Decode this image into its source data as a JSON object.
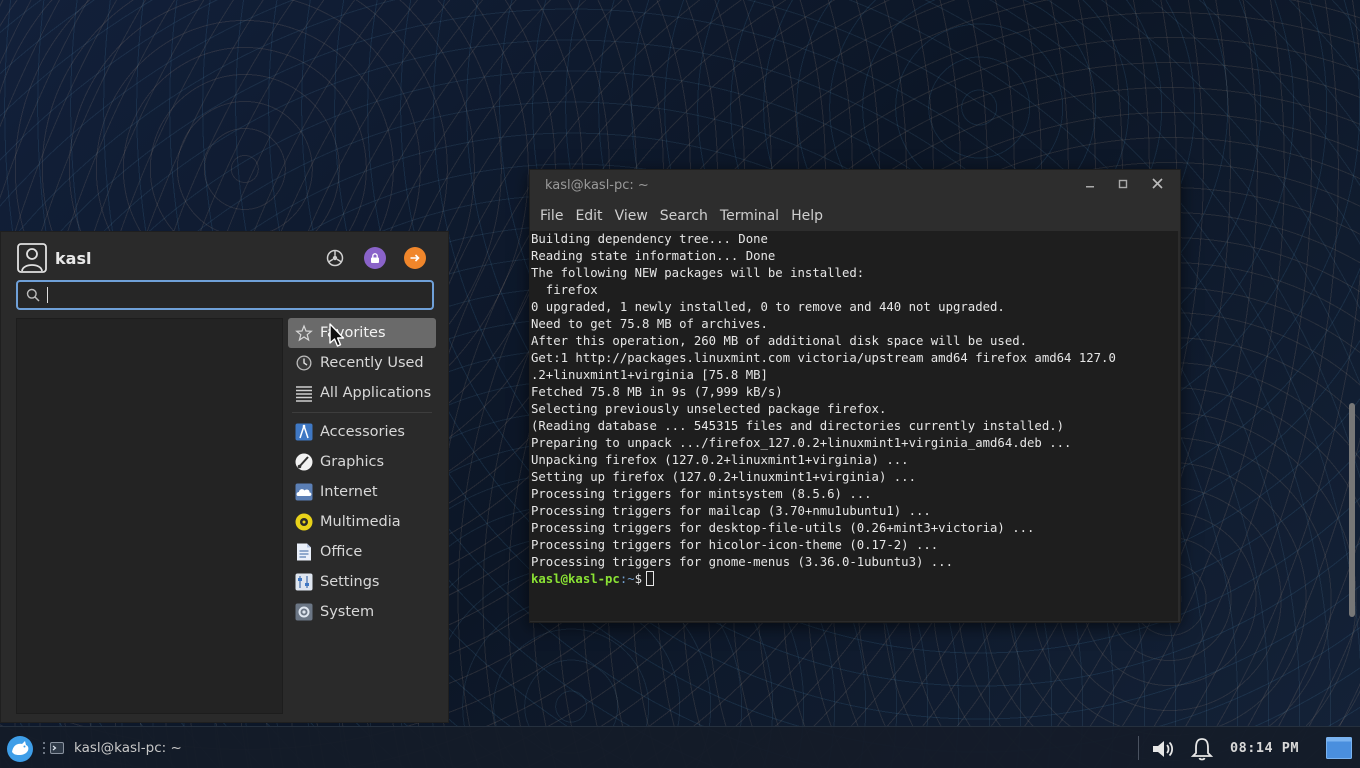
{
  "terminal": {
    "title": "kasl@kasl-pc: ~",
    "menu": [
      "File",
      "Edit",
      "View",
      "Search",
      "Terminal",
      "Help"
    ],
    "lines": [
      "Building dependency tree... Done",
      "Reading state information... Done",
      "The following NEW packages will be installed:",
      "  firefox",
      "0 upgraded, 1 newly installed, 0 to remove and 440 not upgraded.",
      "Need to get 75.8 MB of archives.",
      "After this operation, 260 MB of additional disk space will be used.",
      "Get:1 http://packages.linuxmint.com victoria/upstream amd64 firefox amd64 127.0",
      ".2+linuxmint1+virginia [75.8 MB]",
      "Fetched 75.8 MB in 9s (7,999 kB/s)",
      "Selecting previously unselected package firefox.",
      "(Reading database ... 545315 files and directories currently installed.)",
      "Preparing to unpack .../firefox_127.0.2+linuxmint1+virginia_amd64.deb ...",
      "Unpacking firefox (127.0.2+linuxmint1+virginia) ...",
      "Setting up firefox (127.0.2+linuxmint1+virginia) ...",
      "Processing triggers for mintsystem (8.5.6) ...",
      "Processing triggers for mailcap (3.70+nmu1ubuntu1) ...",
      "Processing triggers for desktop-file-utils (0.26+mint3+victoria) ...",
      "Processing triggers for hicolor-icon-theme (0.17-2) ...",
      "Processing triggers for gnome-menus (3.36.0-1ubuntu3) ..."
    ],
    "prompt": {
      "user": "kasl@kasl-pc",
      "path": ":~",
      "symbol": "$"
    }
  },
  "whisker": {
    "username": "kasl",
    "search": {
      "value": "",
      "placeholder": ""
    },
    "categories_top": [
      {
        "label": "Favorites",
        "icon": "star-icon",
        "selected": true
      },
      {
        "label": "Recently Used",
        "icon": "clock-icon",
        "selected": false
      },
      {
        "label": "All Applications",
        "icon": "list-icon",
        "selected": false
      }
    ],
    "categories": [
      {
        "label": "Accessories",
        "icon": "accessories-icon"
      },
      {
        "label": "Graphics",
        "icon": "graphics-icon"
      },
      {
        "label": "Internet",
        "icon": "internet-icon"
      },
      {
        "label": "Multimedia",
        "icon": "multimedia-icon"
      },
      {
        "label": "Office",
        "icon": "office-icon"
      },
      {
        "label": "Settings",
        "icon": "settings-icon"
      },
      {
        "label": "System",
        "icon": "system-icon"
      }
    ],
    "actions": [
      {
        "name": "settings-manager-icon",
        "color": "#2a2a2a"
      },
      {
        "name": "lock-screen-icon",
        "color": "#8a63c9"
      },
      {
        "name": "log-out-icon",
        "color": "#f0862b"
      }
    ]
  },
  "taskbar": {
    "task_label": "kasl@kasl-pc: ~",
    "clock": "08:14  PM"
  },
  "colors": {
    "prompt_user": "#8ae234",
    "prompt_path": "#729fcf",
    "search_focus": "#6fa0d8",
    "selected_category": "#6a6a6a"
  }
}
